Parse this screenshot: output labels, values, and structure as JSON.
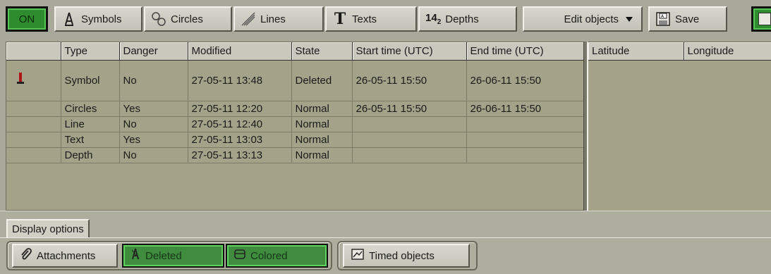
{
  "toolbar": {
    "on_label": "ON",
    "symbols_label": "Symbols",
    "circles_label": "Circles",
    "lines_label": "Lines",
    "texts_label": "Texts",
    "depths_label": "Depths",
    "depths_icon_text": "14",
    "depths_icon_sub": "2",
    "edit_objects_label": "Edit objects",
    "save_label": "Save"
  },
  "table": {
    "columns": [
      "",
      "Type",
      "Danger",
      "Modified",
      "State",
      "Start time (UTC)",
      "End time (UTC)"
    ],
    "rows": [
      {
        "type": "Symbol",
        "danger": "No",
        "modified": "27-05-11 13:48",
        "state": "Deleted",
        "start": "26-05-11 15:50",
        "end": "26-06-11 15:50"
      },
      {
        "type": "Circles",
        "danger": "Yes",
        "modified": "27-05-11 12:20",
        "state": "Normal",
        "start": "26-05-11 15:50",
        "end": "26-06-11 15:50"
      },
      {
        "type": "Line",
        "danger": "No",
        "modified": "27-05-11 12:40",
        "state": "Normal",
        "start": "",
        "end": ""
      },
      {
        "type": "Text",
        "danger": "Yes",
        "modified": "27-05-11 13:03",
        "state": "Normal",
        "start": "",
        "end": ""
      },
      {
        "type": "Depth",
        "danger": "No",
        "modified": "27-05-11 13:13",
        "state": "Normal",
        "start": "",
        "end": ""
      }
    ]
  },
  "coords": {
    "columns": [
      "Latitude",
      "Longitude"
    ]
  },
  "display": {
    "tab_label": "Display options",
    "attachments_label": "Attachments",
    "deleted_label": "Deleted",
    "colored_label": "Colored",
    "timed_label": "Timed objects"
  },
  "colors": {
    "active_green": "#3f8c3f",
    "table_bg": "#a4a38a",
    "marker_red": "#b01515"
  }
}
